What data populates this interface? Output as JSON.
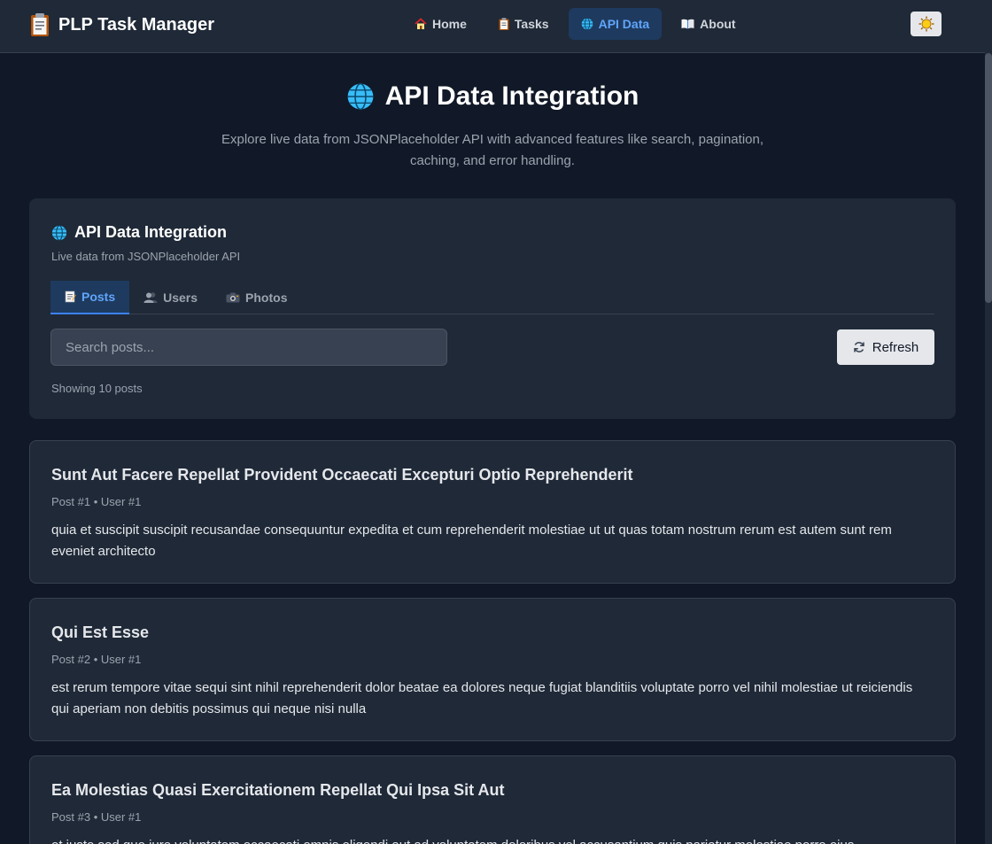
{
  "navbar": {
    "brand": "PLP Task Manager",
    "links": [
      {
        "label": "Home",
        "icon": "house-icon"
      },
      {
        "label": "Tasks",
        "icon": "clipboard-icon"
      },
      {
        "label": "API Data",
        "icon": "globe-icon",
        "active": true
      },
      {
        "label": "About",
        "icon": "book-icon"
      }
    ],
    "theme_toggle_icon": "sun-icon"
  },
  "hero": {
    "title": "API Data Integration",
    "subtitle": "Explore live data from JSONPlaceholder API with advanced features like search, pagination, caching, and error handling."
  },
  "panel": {
    "title": "API Data Integration",
    "subtitle": "Live data from JSONPlaceholder API",
    "tabs": [
      {
        "label": "Posts",
        "icon": "memo-icon",
        "active": true
      },
      {
        "label": "Users",
        "icon": "users-icon"
      },
      {
        "label": "Photos",
        "icon": "camera-icon"
      }
    ],
    "search": {
      "placeholder": "Search posts...",
      "value": ""
    },
    "refresh_label": "Refresh",
    "count_text": "Showing 10 posts"
  },
  "posts": [
    {
      "title": "Sunt Aut Facere Repellat Provident Occaecati Excepturi Optio Reprehenderit",
      "meta": "Post #1 • User #1",
      "body": "quia et suscipit suscipit recusandae consequuntur expedita et cum reprehenderit molestiae ut ut quas totam nostrum rerum est autem sunt rem eveniet architecto"
    },
    {
      "title": "Qui Est Esse",
      "meta": "Post #2 • User #1",
      "body": "est rerum tempore vitae sequi sint nihil reprehenderit dolor beatae ea dolores neque fugiat blanditiis voluptate porro vel nihil molestiae ut reiciendis qui aperiam non debitis possimus qui neque nisi nulla"
    },
    {
      "title": "Ea Molestias Quasi Exercitationem Repellat Qui Ipsa Sit Aut",
      "meta": "Post #3 • User #1",
      "body": "et iusto sed quo iure voluptatem occaecati omnis eligendi aut ad voluptatem doloribus vel accusantium quis pariatur molestiae porro eius"
    }
  ],
  "colors": {
    "background": "#111827",
    "surface": "#1f2937",
    "accent": "#60a5fa",
    "active_bg": "#1e3a5f"
  }
}
